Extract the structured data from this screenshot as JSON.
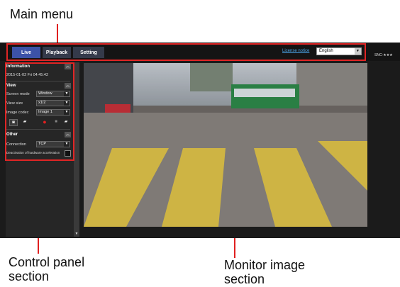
{
  "callouts": {
    "main_menu": "Main menu",
    "control_panel_line1": "Control panel",
    "control_panel_line2": "section",
    "monitor_line1": "Monitor image",
    "monitor_line2": "section"
  },
  "menu": {
    "tabs": [
      "Live",
      "Playback",
      "Setting"
    ],
    "license_link": "License notice",
    "language": "English",
    "model": "SNC-★★★"
  },
  "panel": {
    "information": {
      "title": "Information",
      "datetime": "2015-01-02 Fri 04:45:42"
    },
    "view": {
      "title": "View",
      "rows": [
        {
          "label": "Screen mode",
          "value": "Window"
        },
        {
          "label": "View size",
          "value": "x1/2"
        },
        {
          "label": "Image codec",
          "value": "Image 1"
        }
      ]
    },
    "other": {
      "title": "Other",
      "connection_label": "Connection",
      "connection_value": "TCP",
      "hw_accel_label": "Deactivation of hardware acceleration"
    }
  },
  "colors": {
    "highlight": "#e02525",
    "live_tab": "#3c52a8",
    "link": "#4aa3e6"
  }
}
